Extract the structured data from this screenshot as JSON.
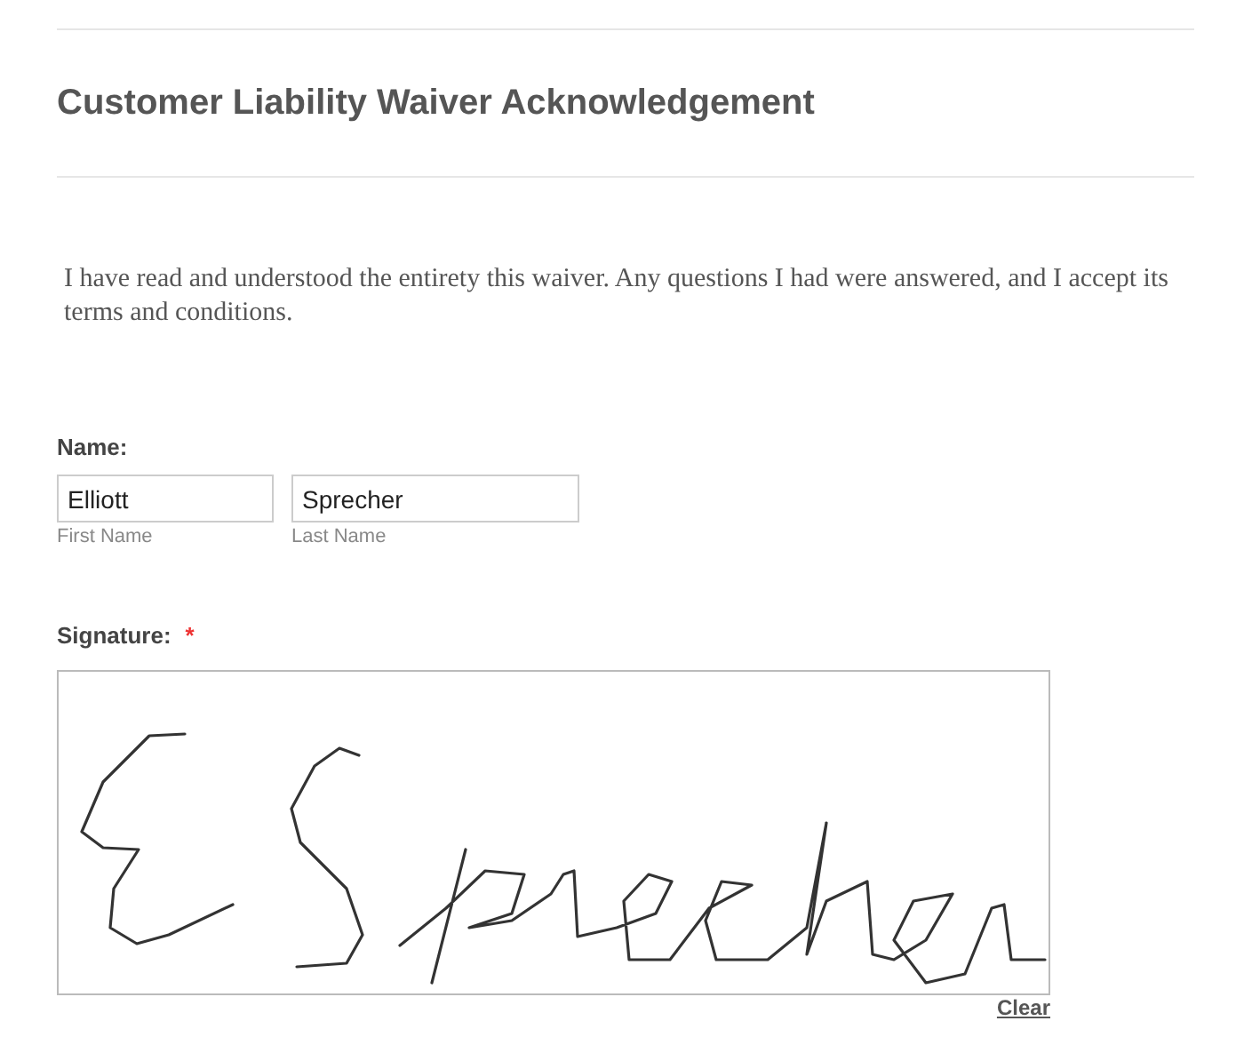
{
  "title": "Customer Liability Waiver Acknowledgement",
  "statement": "I have read and understood the entirety this waiver. Any questions I had were answered, and I accept its terms and conditions.",
  "name_field": {
    "label": "Name:",
    "parts": [
      {
        "value": "Elliott",
        "sublabel": "First Name"
      },
      {
        "value": "Sprecher",
        "sublabel": "Last Name"
      }
    ]
  },
  "signature": {
    "label": "Signature:",
    "required_mark": "*",
    "clear_link": "Clear"
  }
}
